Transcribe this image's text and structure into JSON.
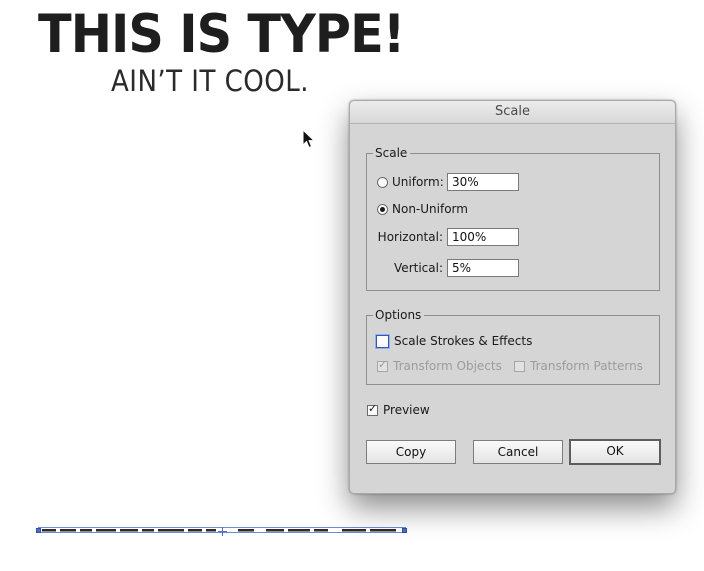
{
  "artboard": {
    "headline": "THIS IS TYPE!",
    "subline": "AIN’T IT COOL.",
    "cursor_icon": "arrow-pointer-icon"
  },
  "dialog": {
    "title": "Scale",
    "scale_group": {
      "title": "Scale",
      "uniform_label": "Uniform:",
      "uniform_value": "30%",
      "uniform_selected": false,
      "non_uniform_label": "Non-Uniform",
      "non_uniform_selected": true,
      "horizontal_label": "Horizontal:",
      "horizontal_value": "100%",
      "vertical_label": "Vertical:",
      "vertical_value": "5%"
    },
    "options_group": {
      "title": "Options",
      "scale_strokes_label": "Scale Strokes & Effects",
      "scale_strokes_checked": false,
      "transform_objects_label": "Transform Objects",
      "transform_objects_checked": true,
      "transform_patterns_label": "Transform Patterns",
      "transform_patterns_checked": false
    },
    "preview_label": "Preview",
    "preview_checked": true,
    "buttons": {
      "copy": "Copy",
      "cancel": "Cancel",
      "ok": "OK"
    }
  },
  "colors": {
    "selection_blue": "#4a6fd0",
    "dialog_bg": "#d5d5d5",
    "headline": "#1e1e1e"
  }
}
